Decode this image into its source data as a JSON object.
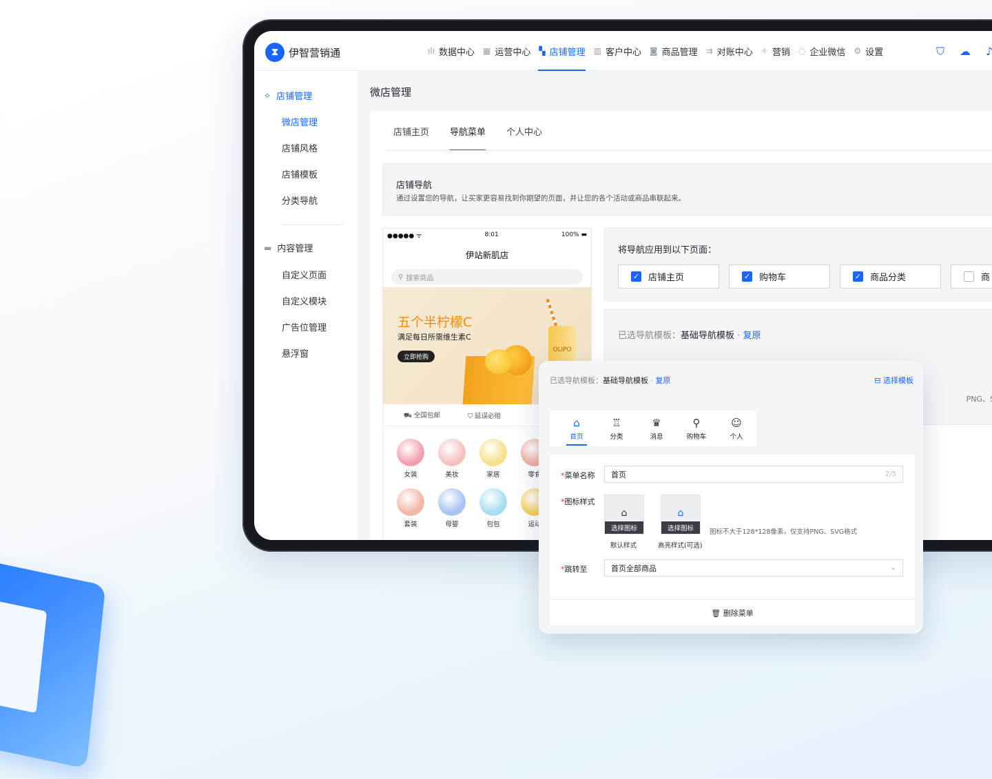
{
  "app": {
    "name": "伊智营销通",
    "logo_glyph": "⧗"
  },
  "topnav": [
    {
      "label": "数据中心",
      "icon": "bar-chart-icon",
      "glyph": "ılı",
      "active": false
    },
    {
      "label": "运营中心",
      "icon": "store-icon",
      "glyph": "▦",
      "active": false
    },
    {
      "label": "店铺管理",
      "icon": "shop-icon",
      "glyph": "▚",
      "active": true
    },
    {
      "label": "客户中心",
      "icon": "book-icon",
      "glyph": "▥",
      "active": false
    },
    {
      "label": "商品管理",
      "icon": "goods-icon",
      "glyph": "◙",
      "active": false
    },
    {
      "label": "对账中心",
      "icon": "reconcile-icon",
      "glyph": "⇉",
      "active": false
    },
    {
      "label": "营销",
      "icon": "marketing-icon",
      "glyph": "✧",
      "active": false
    },
    {
      "label": "企业微信",
      "icon": "wechat-icon",
      "glyph": "◌",
      "active": false
    },
    {
      "label": "设置",
      "icon": "gear-icon",
      "glyph": "⚙",
      "active": false
    }
  ],
  "top_icons": [
    {
      "name": "brush-icon",
      "glyph": "⛉"
    },
    {
      "name": "cloud-upload-icon",
      "glyph": "☁"
    },
    {
      "name": "bell-icon",
      "glyph": "♪"
    }
  ],
  "sidebar": {
    "group1": {
      "label": "店铺管理",
      "glyph": "✧"
    },
    "group1_items": [
      "微店管理",
      "店铺风格",
      "店铺模板",
      "分类导航"
    ],
    "group2": {
      "label": "内容管理",
      "glyph": "▬"
    },
    "group2_items": [
      "自定义页面",
      "自定义模块",
      "广告位管理",
      "悬浮窗"
    ]
  },
  "page_title": "微店管理",
  "tabs": [
    {
      "label": "店铺主页",
      "active": false
    },
    {
      "label": "导航菜单",
      "active": true
    },
    {
      "label": "个人中心",
      "active": false
    }
  ],
  "info": {
    "title": "店铺导航",
    "desc": "通过设置您的导航，让买家更容易找到你期望的页面，并让您的各个活动或商品串联起来。"
  },
  "phone": {
    "signal": "●●●●● ᯤ",
    "time": "8:01",
    "battery": "100% ▬",
    "shop_name": "伊站新肌店",
    "search_placeholder": "搜索商品",
    "banner_title": "五个半柠檬C",
    "banner_sub": "满足每日所需维生素C",
    "banner_btn": "立即抢购",
    "can_text": "OLIPO",
    "perks": [
      "⛟ 全国包邮",
      "⛉ 延误必赔"
    ],
    "categories": [
      {
        "label": "女装",
        "color": "#f3a0b0"
      },
      {
        "label": "美妆",
        "color": "#f6c2c0"
      },
      {
        "label": "家居",
        "color": "#f6e08a"
      },
      {
        "label": "零食",
        "color": "#f2b0a0"
      },
      {
        "label": "套装",
        "color": "#f2b8a8"
      },
      {
        "label": "母婴",
        "color": "#a9c4f2"
      },
      {
        "label": "包包",
        "color": "#a6def0"
      },
      {
        "label": "运动",
        "color": "#f7d060"
      }
    ]
  },
  "apply": {
    "title": "将导航应用到以下页面：",
    "options": [
      {
        "label": "店铺主页",
        "checked": true
      },
      {
        "label": "购物车",
        "checked": true
      },
      {
        "label": "商品分类",
        "checked": true
      },
      {
        "label": "商",
        "checked": false
      }
    ]
  },
  "template": {
    "label": "已选导航模板：",
    "name": "基础导航模板",
    "sep": " · ",
    "reset": "复原"
  },
  "bg_hint": "PNG、SVG格式",
  "float": {
    "label": "已选导航模板：",
    "name": "基础导航模板",
    "sep": " · ",
    "reset": "复原",
    "select_btn": "⊟ 选择模板",
    "tabs": [
      {
        "label": "首页",
        "glyph": "⌂",
        "active": true
      },
      {
        "label": "分类",
        "glyph": "♖",
        "active": false
      },
      {
        "label": "消息",
        "glyph": "♛",
        "active": false
      },
      {
        "label": "购物车",
        "glyph": "⚲",
        "active": false
      },
      {
        "label": "个人",
        "glyph": "☺",
        "active": false
      }
    ],
    "name_label": "菜单名称",
    "name_value": "首页",
    "name_count": "2/5",
    "icon_label": "图标样式",
    "icon_default_btn": "选择图标",
    "icon_default_caption": "默认样式",
    "icon_highlight_btn": "选择图标",
    "icon_highlight_caption": "高亮样式(可选)",
    "icon_hint": "图标不大于128*128像素，仅支持PNG、SVG格式",
    "jump_label": "跳转至",
    "jump_value": "首页全部商品",
    "delete": "🗑 删除菜单"
  }
}
